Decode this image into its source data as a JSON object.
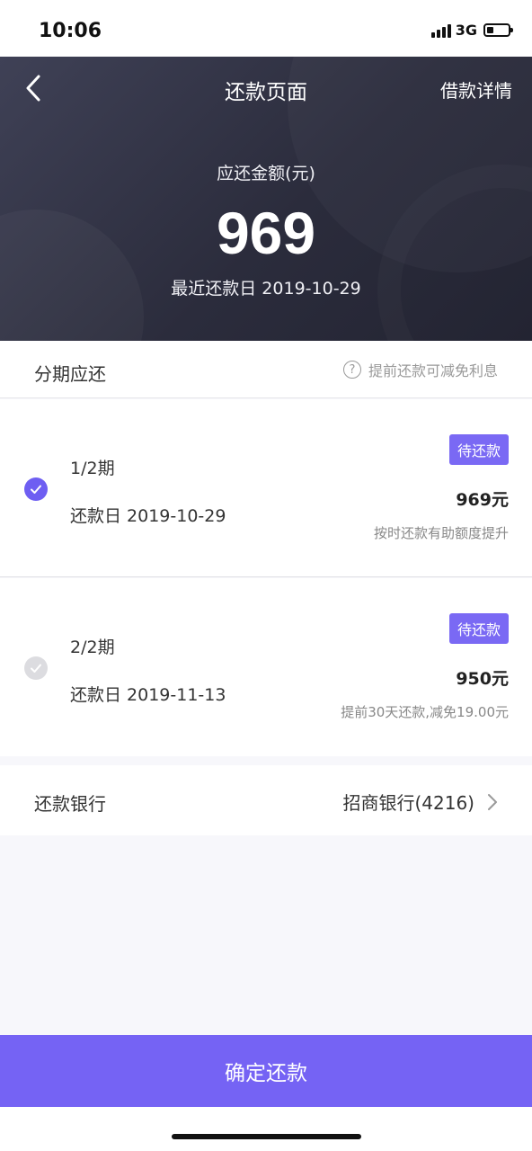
{
  "status_bar": {
    "time": "10:06",
    "network": "3G"
  },
  "header": {
    "title": "还款页面",
    "right_link": "借款详情",
    "amount_label": "应还金额(元)",
    "amount": "969",
    "due_label": "最近还款日 2019-10-29"
  },
  "installments_section": {
    "title": "分期应还",
    "hint": "提前还款可减免利息",
    "help_glyph": "?"
  },
  "installments": [
    {
      "period": "1/2期",
      "date": "还款日 2019-10-29",
      "badge": "待还款",
      "amount": "969元",
      "note": "按时还款有助额度提升",
      "selected": true
    },
    {
      "period": "2/2期",
      "date": "还款日 2019-11-13",
      "badge": "待还款",
      "amount": "950元",
      "note": "提前30天还款,减免19.00元",
      "selected": false
    }
  ],
  "bank": {
    "label": "还款银行",
    "value": "招商银行(4216)"
  },
  "confirm_button": "确定还款",
  "colors": {
    "accent": "#7563f4",
    "header_bg": "#2b2c3c",
    "check_off": "#dcdce0"
  },
  "icons": {
    "back": "chevron-left-icon",
    "help": "question-circle-icon",
    "check": "check-circle-icon",
    "arrow": "chevron-right-icon"
  }
}
